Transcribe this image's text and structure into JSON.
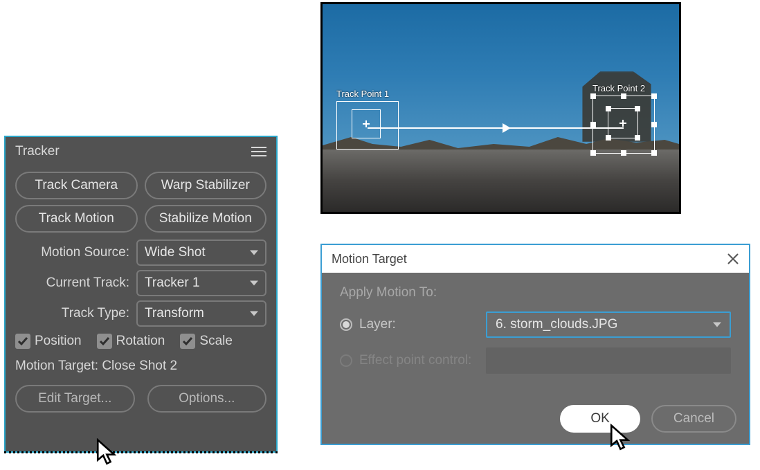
{
  "tracker": {
    "title": "Tracker",
    "buttons": {
      "track_camera": "Track Camera",
      "warp_stabilizer": "Warp Stabilizer",
      "track_motion": "Track Motion",
      "stabilize_motion": "Stabilize Motion"
    },
    "motion_source": {
      "label": "Motion Source:",
      "value": "Wide Shot"
    },
    "current_track": {
      "label": "Current Track:",
      "value": "Tracker 1"
    },
    "track_type": {
      "label": "Track Type:",
      "value": "Transform"
    },
    "checkboxes": {
      "position": {
        "label": "Position",
        "checked": true
      },
      "rotation": {
        "label": "Rotation",
        "checked": true
      },
      "scale": {
        "label": "Scale",
        "checked": true
      }
    },
    "motion_target_line": "Motion Target: Close Shot 2",
    "edit_target": "Edit Target...",
    "options": "Options..."
  },
  "preview": {
    "track_point_1": "Track Point 1",
    "track_point_2": "Track Point 2"
  },
  "dialog": {
    "title": "Motion Target",
    "apply_label": "Apply Motion To:",
    "layer_radio": "Layer:",
    "layer_value": "6. storm_clouds.JPG",
    "effect_radio": "Effect point control:",
    "ok": "OK",
    "cancel": "Cancel"
  }
}
